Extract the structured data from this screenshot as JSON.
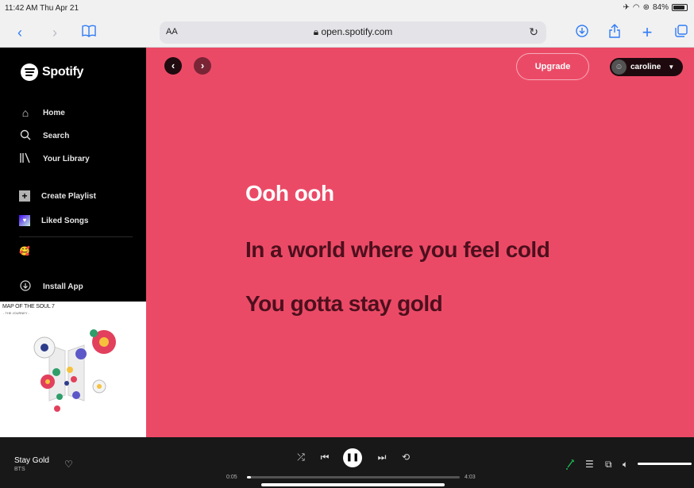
{
  "status_bar": {
    "time": "11:42 AM  Thu Apr 21",
    "battery": "84%"
  },
  "safari": {
    "text_size_label": "AA",
    "url": "open.spotify.com",
    "icons": [
      "back-icon",
      "forward-icon",
      "bookmarks-icon",
      "reload-icon",
      "download-icon",
      "share-icon",
      "new-tab-icon",
      "tabs-icon"
    ],
    "accent": "#2f7cf6"
  },
  "sidebar": {
    "logo": "Spotify",
    "nav": [
      {
        "label": "Home",
        "icon": "home-icon"
      },
      {
        "label": "Search",
        "icon": "search-icon"
      },
      {
        "label": "Your Library",
        "icon": "library-icon"
      }
    ],
    "create_playlist": "Create Playlist",
    "liked_songs": "Liked Songs",
    "emoji_playlist": "🥰",
    "install_app": "Install App",
    "album_art": {
      "title": "MAP OF THE SOUL 7",
      "subtitle": "- THE JOURNEY -"
    }
  },
  "header": {
    "upgrade": "Upgrade",
    "username": "caroline"
  },
  "lyrics": [
    {
      "text": "Ooh ooh",
      "state": "active"
    },
    {
      "text": "In a world where you feel cold",
      "state": "upcoming"
    },
    {
      "text": "You gotta stay gold",
      "state": "upcoming"
    }
  ],
  "player": {
    "track": "Stay Gold",
    "artist": "BTS",
    "elapsed": "0:05",
    "duration": "4:03",
    "progress_fraction": 0.02,
    "volume_fraction": 1.0,
    "is_playing": true
  },
  "colors": {
    "lyrics_background": "#eb4a66",
    "active_lyric": "#ffffff",
    "upcoming_lyric": "#4d0f1d",
    "spotify_green": "#1db954"
  }
}
